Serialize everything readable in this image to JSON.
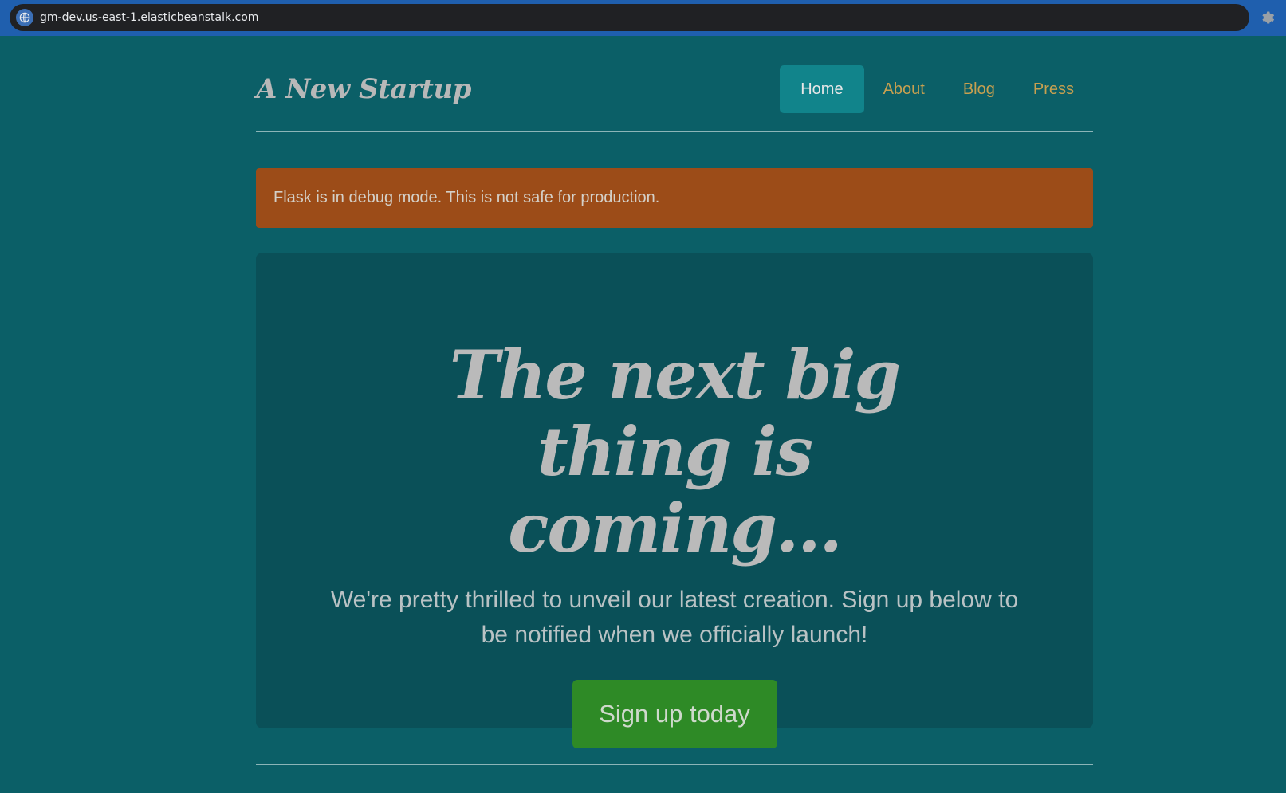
{
  "browser": {
    "url": "gm-dev.us-east-1.elasticbeanstalk.com",
    "site_icon": "globe-icon",
    "settings_icon": "gear-icon"
  },
  "header": {
    "brand": "A New Startup",
    "nav": [
      {
        "label": "Home",
        "active": true
      },
      {
        "label": "About",
        "active": false
      },
      {
        "label": "Blog",
        "active": false
      },
      {
        "label": "Press",
        "active": false
      }
    ]
  },
  "alert": {
    "message": "Flask is in debug mode. This is not safe for production."
  },
  "hero": {
    "headline": "The next big thing is coming...",
    "lead": "We're pretty thrilled to unveil our latest creation. Sign up below to be notified when we officially launch!",
    "cta_label": "Sign up today"
  },
  "colors": {
    "page_bg": "#0b5f67",
    "nav_active": "#11848b",
    "nav_link": "#c7a050",
    "alert_bg": "#9c4c18",
    "jumbotron_bg": "#0a5058",
    "cta_bg": "#2e8a26"
  }
}
